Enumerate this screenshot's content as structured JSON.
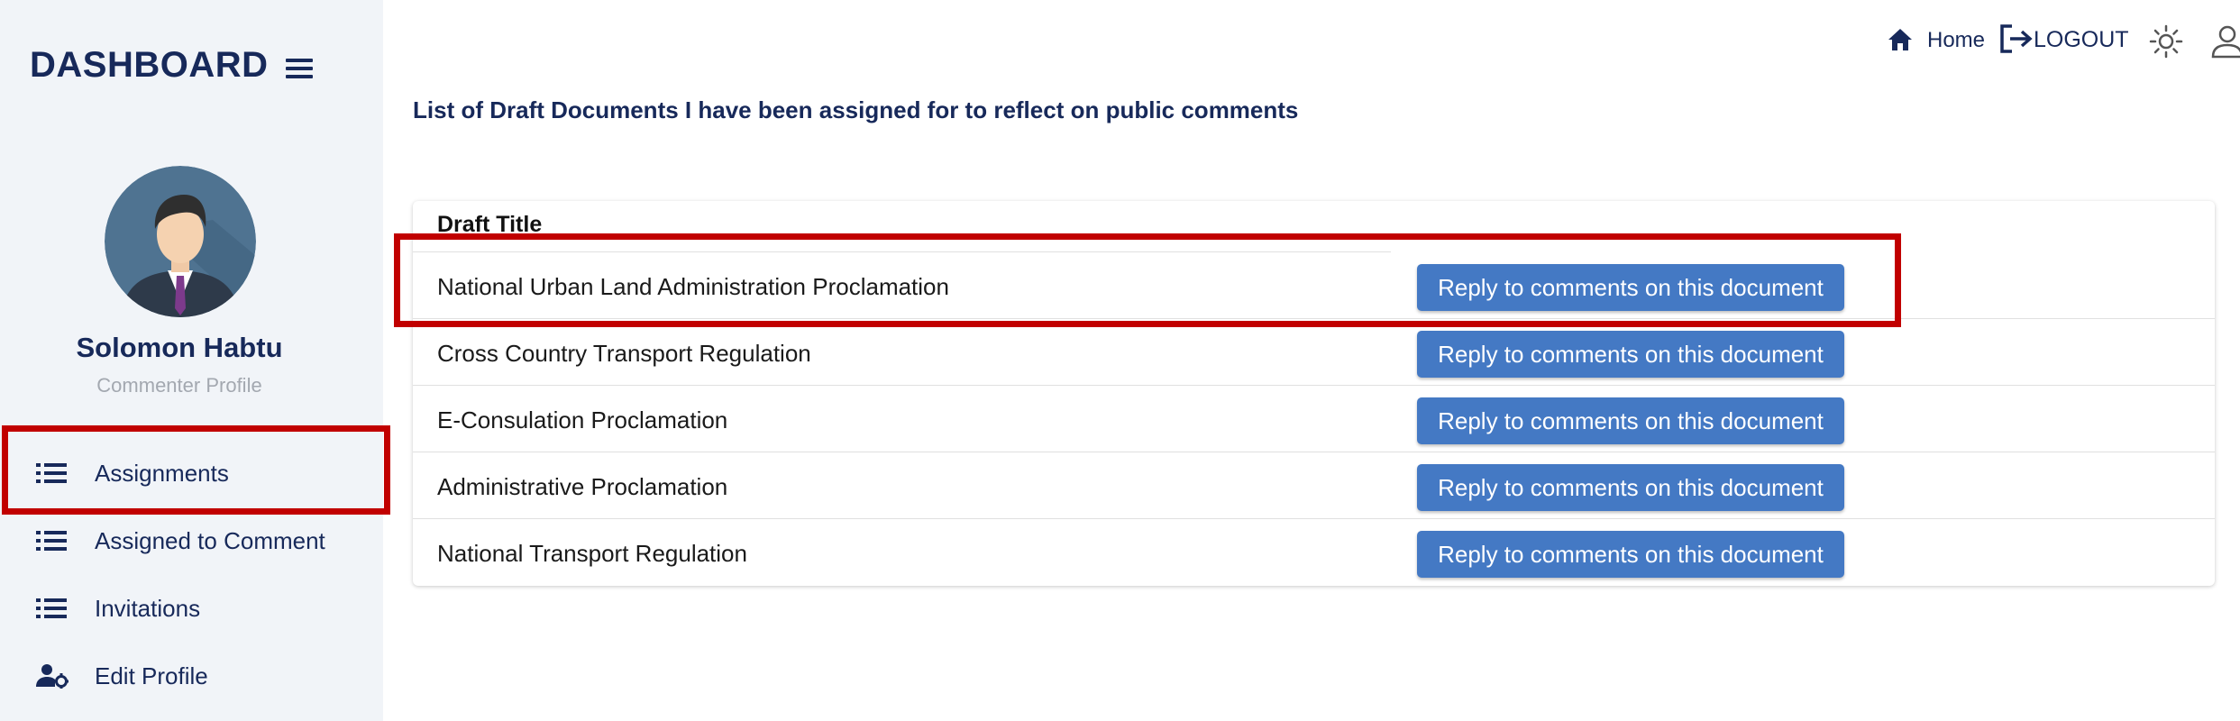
{
  "sidebar": {
    "brand": "DASHBOARD",
    "user": {
      "name": "Solomon Habtu",
      "role": "Commenter Profile"
    },
    "nav": [
      {
        "label": "Assignments",
        "icon": "list-icon"
      },
      {
        "label": "Assigned to Comment",
        "icon": "list-icon"
      },
      {
        "label": "Invitations",
        "icon": "list-icon"
      },
      {
        "label": "Edit Profile",
        "icon": "user-cog-icon"
      }
    ]
  },
  "topbar": {
    "home_label": "Home",
    "logout_label": "LOGOUT",
    "icons": [
      "home-icon",
      "logout-icon",
      "theme-sun-icon",
      "account-icon"
    ]
  },
  "main": {
    "title": "List of Draft Documents I have been assigned for to reflect on public comments",
    "table": {
      "column_header": "Draft Title",
      "button_label": "Reply to comments on this document",
      "rows": [
        {
          "title": "National Urban Land Administration Proclamation"
        },
        {
          "title": "Cross Country Transport Regulation"
        },
        {
          "title": "E-Consulation Proclamation"
        },
        {
          "title": "Administrative Proclamation"
        },
        {
          "title": "National Transport Regulation"
        }
      ]
    }
  },
  "colors": {
    "navy": "#17295a",
    "sidebar_bg": "#f1f4f8",
    "button_bg": "#4479c4",
    "highlight": "#c10000"
  }
}
